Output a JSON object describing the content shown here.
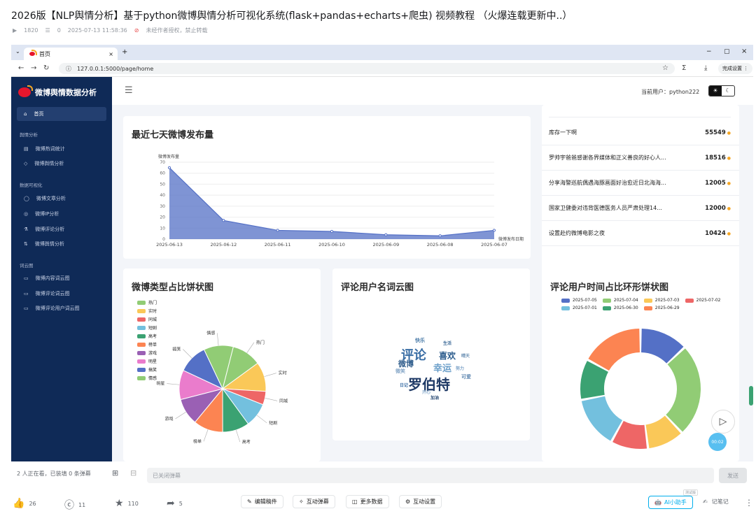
{
  "video": {
    "title": "2026版【NLP舆情分析】基于python微博舆情分析可视化系统(flask+pandas+echarts+爬虫) 视频教程 （火爆连载更新中..）",
    "views": "1820",
    "danmaku": "0",
    "date": "2025-07-13 11:58:36",
    "no_repost": "未经作者授权，禁止转载"
  },
  "browser": {
    "tab_title": "首页",
    "url": "127.0.0.1:5000/page/home",
    "profile_label": "完成设置"
  },
  "app": {
    "brand": "微博舆情数据分析",
    "current_user_label": "当前用户：",
    "current_user": "python222",
    "nav": [
      {
        "label": "首页",
        "icon": "home-icon"
      },
      {
        "section": "舆情分析"
      },
      {
        "label": "微博热词统计",
        "icon": "hot-icon"
      },
      {
        "label": "微博舆情分析",
        "icon": "tag-icon"
      },
      {
        "section": "数据可视化"
      },
      {
        "label": "微博文章分析",
        "icon": "chat-icon"
      },
      {
        "label": "微博IP分析",
        "icon": "location-icon"
      },
      {
        "label": "微博评论分析",
        "icon": "flask-icon"
      },
      {
        "label": "微博舆情分析",
        "icon": "chart-icon"
      },
      {
        "section": "词云图"
      },
      {
        "label": "微博内容词云图",
        "icon": "cloud-icon"
      },
      {
        "label": "微博评论词云图",
        "icon": "cloud-icon"
      },
      {
        "label": "微博评论用户词云图",
        "icon": "cloud-icon"
      }
    ]
  },
  "cards": {
    "line_title": "最近七天微博发布量",
    "pie_title": "微博类型占比饼状图",
    "cloud_title": "评论用户名词云图",
    "donut_title": "评论用户时间占比环形饼状图"
  },
  "hot_list": [
    {
      "text": "库存一下啊",
      "num": "55549"
    },
    {
      "text": "罗帅宇爸爸感谢各界媒体和正义善良的好心人...",
      "num": "18516"
    },
    {
      "text": "分享海警巡航偶遇海豚画面好治愈近日北海海...",
      "num": "12005"
    },
    {
      "text": "国家卫健委对违背医德医务人员严肃处理14...",
      "num": "12000"
    },
    {
      "text": "设置赴约微博电影之夜",
      "num": "10424"
    }
  ],
  "wordcloud": [
    "评论",
    "罗伯特",
    "喜欢",
    "幸运",
    "快乐",
    "微博",
    "微笑",
    "可爱",
    "努力",
    "生活",
    "开心",
    "日记",
    "晴天",
    "加油"
  ],
  "chart_data": [
    {
      "type": "area",
      "title": "最近七天微博发布量",
      "ylabel": "微博发布量",
      "xlabel": "微博发布日期",
      "categories": [
        "2025-06-13",
        "2025-06-12",
        "2025-06-11",
        "2025-06-10",
        "2025-06-09",
        "2025-06-08",
        "2025-06-07"
      ],
      "values": [
        65,
        17,
        8,
        7,
        4,
        3,
        8
      ],
      "ylim": [
        0,
        70
      ],
      "yticks": [
        0,
        10,
        20,
        30,
        40,
        50,
        60,
        70
      ],
      "color": "#5470c6"
    },
    {
      "type": "pie",
      "title": "微博类型占比饼状图",
      "slices": [
        {
          "name": "热门",
          "value": 11,
          "color": "#91cc75"
        },
        {
          "name": "实时",
          "value": 11,
          "color": "#fac858"
        },
        {
          "name": "同城",
          "value": 5,
          "color": "#ee6666"
        },
        {
          "name": "短剧",
          "value": 9,
          "color": "#73c0de"
        },
        {
          "name": "高考",
          "value": 10,
          "color": "#3ba272"
        },
        {
          "name": "榜单",
          "value": 11,
          "color": "#fc8452"
        },
        {
          "name": "游戏",
          "value": 10,
          "color": "#9a60b4"
        },
        {
          "name": "明星",
          "value": 11,
          "color": "#ea7ccc"
        },
        {
          "name": "搞笑",
          "value": 11,
          "color": "#5470c6"
        },
        {
          "name": "情感",
          "value": 11,
          "color": "#91cc75"
        }
      ]
    },
    {
      "type": "pie",
      "title": "评论用户时间占比环形饼状图",
      "slices": [
        {
          "name": "2025-07-05",
          "value": 13,
          "color": "#5470c6"
        },
        {
          "name": "2025-07-04",
          "value": 25,
          "color": "#91cc75"
        },
        {
          "name": "2025-07-03",
          "value": 10,
          "color": "#fac858"
        },
        {
          "name": "2025-07-02",
          "value": 10,
          "color": "#ee6666"
        },
        {
          "name": "2025-07-01",
          "value": 14,
          "color": "#73c0de"
        },
        {
          "name": "2025-06-30",
          "value": 11,
          "color": "#3ba272"
        },
        {
          "name": "2025-06-29",
          "value": 17,
          "color": "#fc8452"
        }
      ]
    }
  ],
  "player": {
    "watching": "2 人正在看，已装填 0 条弹幕",
    "danmaku_off": "已关闭弹幕",
    "send": "发送",
    "timer": "00:02"
  },
  "actions": {
    "like": "26",
    "coin": "11",
    "fav": "110",
    "share": "5",
    "edit": "编辑稿件",
    "interact": "互动弹幕",
    "more": "更多数据",
    "settings": "互动设置",
    "ai": "AI小助手",
    "ai_badge": "测试版",
    "notes": "记笔记"
  }
}
